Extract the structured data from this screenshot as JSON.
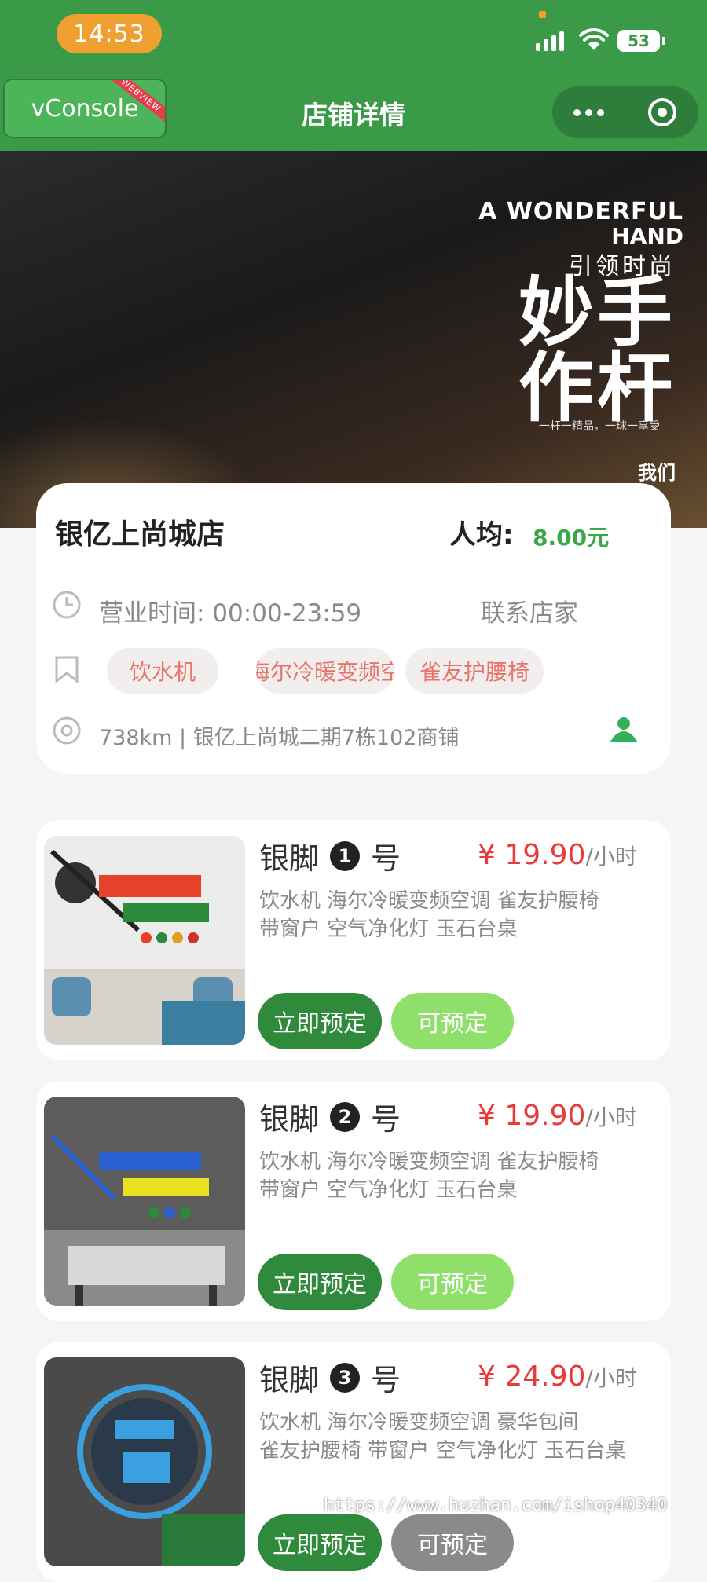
{
  "status_bar": {
    "time": "14:53",
    "battery": "53"
  },
  "nav": {
    "vconsole": "vConsole",
    "ribbon": "WEBVIEW",
    "title": "店铺详情"
  },
  "banner": {
    "en_line1": "A WONDERFUL",
    "en_line2": "HAND",
    "cn_line": "引领时尚",
    "big_line1": "妙手",
    "big_line2": "作杆",
    "small_text": "一杆一精品，一球一享受",
    "side_text": "我们"
  },
  "store": {
    "name": "银亿上尚城店",
    "avg_label": "人均:",
    "avg_value": "8.00元",
    "hours": "营业时间:  00:00-23:59",
    "contact": "联系店家",
    "tags": [
      "饮水机",
      "海尔冷暖变频空",
      "雀友护腰椅"
    ],
    "address": "738km | 银亿上尚城二期7栋102商铺"
  },
  "rooms": [
    {
      "name": "银脚",
      "num": "1",
      "suffix": "号",
      "price": "¥ 19.90",
      "unit": "/小时",
      "features_line1": "饮水机  海尔冷暖变频空调  雀友护腰椅",
      "features_line2": "带窗户  空气净化灯  玉石台桌",
      "book_label": "立即预定",
      "avail_label": "可预定"
    },
    {
      "name": "银脚",
      "num": "2",
      "suffix": "号",
      "price": "¥ 19.90",
      "unit": "/小时",
      "features_line1": "饮水机  海尔冷暖变频空调  雀友护腰椅",
      "features_line2": "带窗户  空气净化灯  玉石台桌",
      "book_label": "立即预定",
      "avail_label": "可预定"
    },
    {
      "name": "银脚",
      "num": "3",
      "suffix": "号",
      "price": "¥ 24.90",
      "unit": "/小时",
      "features_line1": "饮水机  海尔冷暖变频空调  豪华包间",
      "features_line2": "雀友护腰椅  带窗户  空气净化灯  玉石台桌",
      "book_label": "立即预定",
      "avail_label": "可预定"
    }
  ],
  "watermark": "https://www.huzhan.com/ishop40340",
  "colors": {
    "brand_green": "#3a9a47",
    "price_red": "#e83a3a",
    "book_green": "#2f8a3c",
    "avail_green": "#8ee06a"
  },
  "icons": [
    "clock-icon",
    "bookmark-icon",
    "location-icon",
    "map-user-icon",
    "more-icon",
    "close-capsule-icon"
  ]
}
